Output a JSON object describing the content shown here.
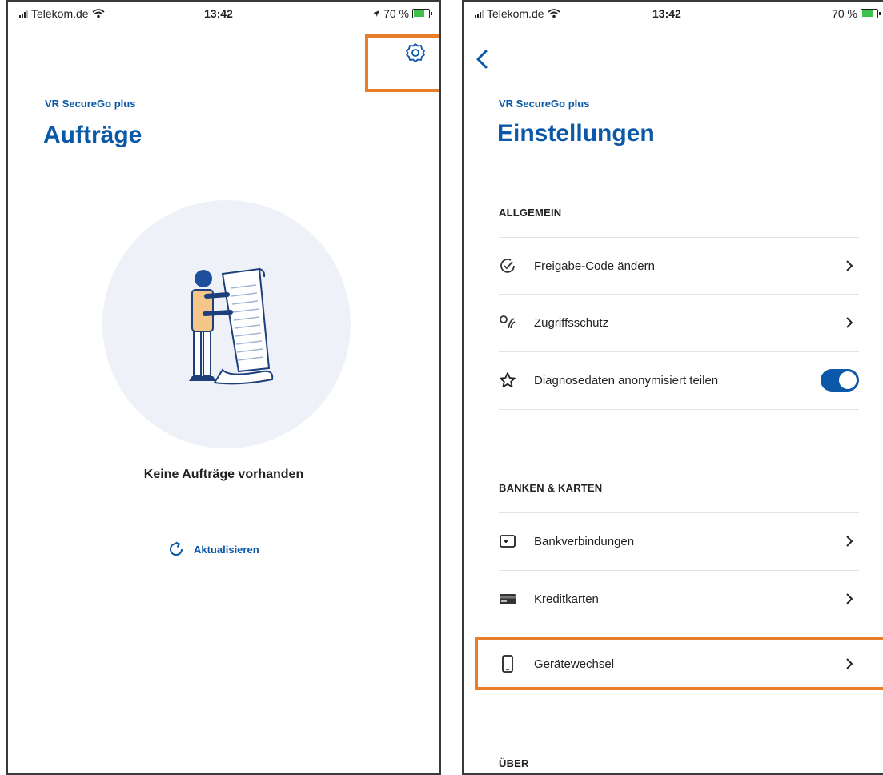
{
  "left": {
    "status": {
      "carrier": "Telekom.de",
      "time": "13:42",
      "battery": "70 %",
      "battery_level": 0.7
    },
    "brand": "VR SecureGo plus",
    "title": "Aufträge",
    "empty_message": "Keine Aufträge vorhanden",
    "refresh_label": "Aktualisieren",
    "icons": {
      "settings": "gear-icon",
      "refresh": "refresh-icon",
      "illustration": "person-holding-list-illustration"
    }
  },
  "right": {
    "status": {
      "carrier": "Telekom.de",
      "time": "13:42",
      "battery": "70 %",
      "battery_level": 0.7
    },
    "brand": "VR SecureGo plus",
    "title": "Einstellungen",
    "sections": [
      {
        "header": "ALLGEMEIN",
        "items": [
          {
            "label": "Freigabe-Code ändern",
            "icon": "check-circle-icon",
            "control": "chevron"
          },
          {
            "label": "Zugriffsschutz",
            "icon": "fingerprint-key-icon",
            "control": "chevron"
          },
          {
            "label": "Diagnosedaten anonymisiert teilen",
            "icon": "star-icon",
            "control": "toggle",
            "enabled": true
          }
        ]
      },
      {
        "header": "BANKEN & KARTEN",
        "items": [
          {
            "label": "Bankverbindungen",
            "icon": "bank-card-icon",
            "control": "chevron"
          },
          {
            "label": "Kreditkarten",
            "icon": "credit-card-icon",
            "control": "chevron"
          },
          {
            "label": "Gerätewechsel",
            "icon": "smartphone-icon",
            "control": "chevron"
          }
        ]
      },
      {
        "header": "ÜBER",
        "items": []
      }
    ]
  },
  "colors": {
    "accent": "#0b58a8",
    "highlight": "#e87d2a",
    "illustration_bg": "#eef2f8"
  }
}
